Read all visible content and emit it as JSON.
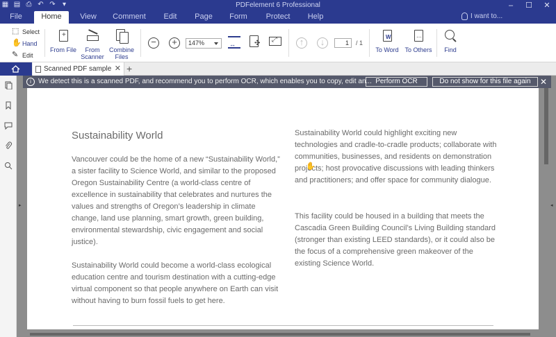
{
  "app": {
    "title": "PDFelement 6 Professional"
  },
  "menu": {
    "tabs": [
      {
        "label": "File"
      },
      {
        "label": "Home"
      },
      {
        "label": "View"
      },
      {
        "label": "Comment"
      },
      {
        "label": "Edit"
      },
      {
        "label": "Page"
      },
      {
        "label": "Form"
      },
      {
        "label": "Protect"
      },
      {
        "label": "Help"
      }
    ],
    "active": "Home",
    "search_hint": "I want to..."
  },
  "ribbon": {
    "modes": {
      "select": "Select",
      "hand": "Hand",
      "edit": "Edit"
    },
    "from_file": "From File",
    "from_scanner": "From\nScanner",
    "combine_files": "Combine\nFiles",
    "zoom": "147%",
    "page_current": "1",
    "page_total": "/ 1",
    "to_word": "To Word",
    "to_others": "To Others",
    "find": "Find"
  },
  "tabs": {
    "document": "Scanned PDF sample"
  },
  "notice": {
    "text": "We detect this is a scanned PDF, and recommend you to perform OCR, which enables you to copy, edit an...",
    "perform_ocr": "Perform OCR",
    "dont_show": "Do not show for this file again"
  },
  "document": {
    "title": "Sustainability World",
    "left_p1": "Vancouver could be the home of a new “Sustainability World,” a sister facility to Science World, and similar to the proposed Oregon Sustainability Centre (a world-class centre of excellence in sustainability that celebrates and nurtures the values and strengths of Oregon’s leadership in climate change, land use planning, smart growth, green building, environmental stewardship, civic engagement and social justice).",
    "left_p2": "Sustainability World could become a world-class ecological education centre and tourism destination with a cutting-edge virtual component so that people anywhere on Earth can visit without having to burn fossil fuels to get here.",
    "right_p1": "Sustainability World could highlight exciting new technologies and cradle-to-cradle products; collaborate with communities, businesses, and residents on demonstration projects; host provocative discussions with leading thinkers and practitioners; and offer space for community dialogue.",
    "right_p2": "This facility could be housed in a building that meets the Cascadia Green Building Council’s Living Building standard (stronger than existing LEED standards), or it could also be the focus of a comprehensive green makeover of the existing Science World."
  }
}
